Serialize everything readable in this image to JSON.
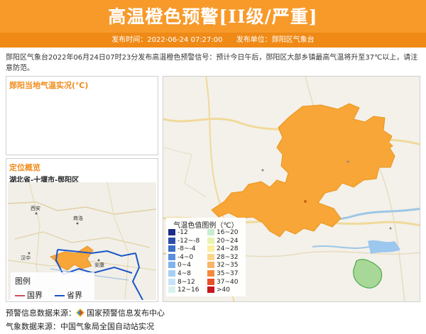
{
  "header": {
    "title": "高温橙色预警[II级/严重]",
    "publish_time": "发布时间：2022-06-24 07:27:00",
    "publisher": "发布单位：郧阳区气象台"
  },
  "intro": "郧阳区气象台2022年06月24日07时23分发布高温橙色预警信号：预计今日午后，郧阳区大部乡镇最高气温将升至37℃以上，请注意防范。",
  "temperature_panel": {
    "title": "郧阳当地气温实况(℃)"
  },
  "location_panel": {
    "title": "定位概览",
    "region": "湖北省-十堰市-郧阳区",
    "map_labels": [
      "西安",
      "商洛",
      "汉中",
      "安康"
    ]
  },
  "legend": {
    "title": "图例",
    "national_border": "国界",
    "provincial_border": "省界",
    "colors": {
      "national": "#c9505a",
      "provincial": "#1a55c8"
    }
  },
  "temperature_scale": {
    "title": "气温色值图例（℃）",
    "items": [
      {
        "label": "-12",
        "color": "#1c2c8a"
      },
      {
        "label": "16~20",
        "color": "#c8eecf"
      },
      {
        "label": "-12~-8",
        "color": "#2c4ea8"
      },
      {
        "label": "20~24",
        "color": "#e8f4b0"
      },
      {
        "label": "-8~-4",
        "color": "#3c6fc8"
      },
      {
        "label": "24~28",
        "color": "#fbf0a0"
      },
      {
        "label": "-4~0",
        "color": "#5a8fde"
      },
      {
        "label": "28~32",
        "color": "#fcd68a"
      },
      {
        "label": "0~4",
        "color": "#80b2ee"
      },
      {
        "label": "32~35",
        "color": "#fbb468"
      },
      {
        "label": "4~8",
        "color": "#a7cff5"
      },
      {
        "label": "35~37",
        "color": "#f58a3e"
      },
      {
        "label": "8~12",
        "color": "#c6e3f8"
      },
      {
        "label": "37~40",
        "color": "#e8502a"
      },
      {
        "label": "12~16",
        "color": "#d8f2ef"
      },
      {
        "label": ">40",
        "color": "#c8161e"
      }
    ]
  },
  "sources": {
    "warning_source": "预警信息数据来源：",
    "warning_source_name": "国家预警信息发布中心",
    "weather_source": "气象数据来源：中国气象局全国自动站实况"
  },
  "colors": {
    "banner": "#f79a2a",
    "banner_meta": "#ef8a17",
    "heat_area": "#f7a637",
    "accent_title": "#f08c1a"
  }
}
